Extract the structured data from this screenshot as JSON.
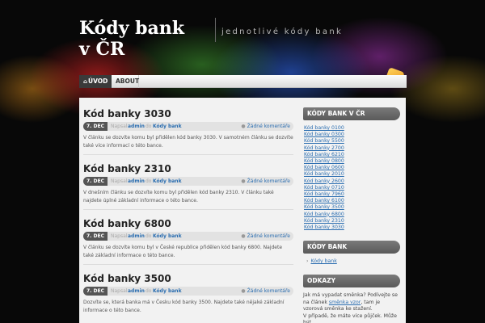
{
  "site": {
    "title": "Kódy bank v ČR",
    "tagline": "jednotlivé kódy bank"
  },
  "nav": {
    "items": [
      {
        "label": "ÚVOD",
        "icon": "home-icon",
        "active": true
      },
      {
        "label": "ABOUT",
        "active": false
      }
    ]
  },
  "posts": [
    {
      "title": "Kód banky 3030",
      "date": "7. DEC",
      "by": "Napsal",
      "author": "admin",
      "in": "do",
      "category": "Kódy bank",
      "comments": "Žádné komentáře",
      "excerpt": "V článku se dozvíte komu byl přidělen kód banky 3030. V samotném článku se dozvíte také více informací o této bance."
    },
    {
      "title": "Kód banky 2310",
      "date": "7. DEC",
      "by": "Napsal",
      "author": "admin",
      "in": "do",
      "category": "Kódy bank",
      "comments": "Žádné komentáře",
      "excerpt": "V dnešním článku se dozvíte komu byl přidělen kód banky 2310. V článku také najdete úplné základní informace o této bance."
    },
    {
      "title": "Kód banky 6800",
      "date": "7. DEC",
      "by": "Napsal",
      "author": "admin",
      "in": "do",
      "category": "Kódy bank",
      "comments": "Žádné komentáře",
      "excerpt": "V článku se dozvíte komu byl v České republice přidělen kód banky 6800. Najdete také základní informace o této bance."
    },
    {
      "title": "Kód banky 3500",
      "date": "7. DEC",
      "by": "Napsal",
      "author": "admin",
      "in": "do",
      "category": "Kódy bank",
      "comments": "Žádné komentáře",
      "excerpt": "Dozvíte se, která banka má v Česku kód banky 3500. Najdete také nějaké základní informace o této bance."
    }
  ],
  "sidebar": {
    "codes_title": "KÓDY BANK V ČR",
    "codes": [
      "Kód banky 0100",
      "Kód banky 0300",
      "Kód banky 5500",
      "Kód banky 2700",
      "Kód banky 6210",
      "Kód banky 0800",
      "Kód banky 0600",
      "Kód banky 2010",
      "Kód banky 2600",
      "Kód banky 0710",
      "Kód banky 7960",
      "Kód banky 6100",
      "Kód banky 3500",
      "Kód banky 6800",
      "Kód banky 2310",
      "Kód banky 3030"
    ],
    "category_title": "KÓDY BANK",
    "categories": [
      "Kódy bank"
    ],
    "links_title": "ODKAZY",
    "links_text_1": "Jak má vypadat směnka? Podívejte se na článek",
    "links_link_1": "směnka vzor",
    "links_text_2": ", tam je vzorová směnka ke stažení.",
    "links_text_3": "V případě, že máte více půjček. Může být"
  },
  "colors": {
    "link": "#2a6db0",
    "widget_header": "#666666",
    "date_badge": "#555555"
  }
}
